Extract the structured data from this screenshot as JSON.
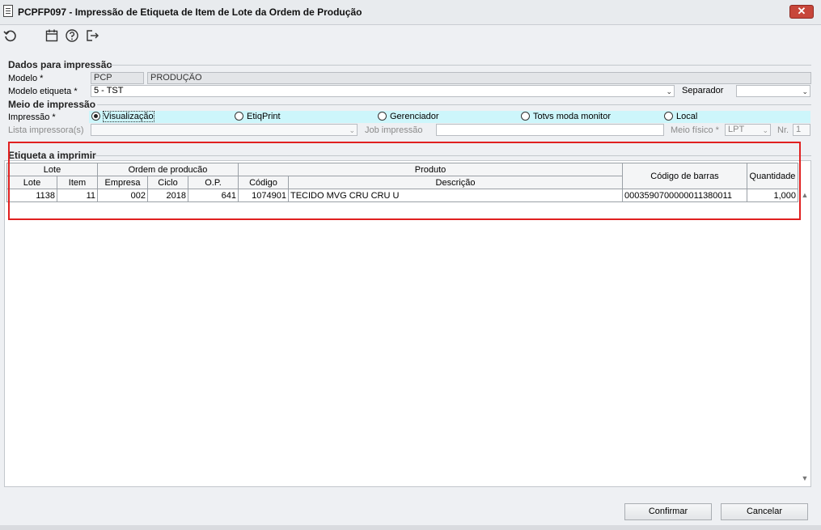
{
  "window": {
    "title": "PCPFP097 - Impressão de Etiqueta de Item de Lote da Ordem de Produção",
    "close_label": "✕"
  },
  "toolbar": {
    "icons": [
      "undo-icon",
      "calendar-icon",
      "help-icon",
      "exit-icon"
    ]
  },
  "dados": {
    "section_title": "Dados para impressão",
    "modelo_label": "Modelo *",
    "modelo_code": "PCP",
    "modelo_desc": "PRODUÇÃO",
    "modelo_etiqueta_label": "Modelo etiqueta *",
    "modelo_etiqueta_value": "5 - TST",
    "separador_label": "Separador",
    "separador_value": ""
  },
  "meio": {
    "section_title": "Meio de impressão",
    "impressao_label": "Impressão *",
    "options": [
      "Visualização",
      "EtiqPrint",
      "Gerenciador",
      "Totvs moda monitor",
      "Local"
    ],
    "selected": "Visualização",
    "lista_label": "Lista impressora(s)",
    "lista_value": "",
    "job_label": "Job impressão",
    "job_value": "",
    "meio_fisico_label": "Meio físico *",
    "meio_fisico_value": "LPT",
    "nr_label": "Nr.",
    "nr_value": "1"
  },
  "etiqueta": {
    "section_title": "Etiqueta a imprimir",
    "group_headers": {
      "lote": "Lote",
      "ordem": "Ordem de producão",
      "produto": "Produto",
      "barras": "Código de barras",
      "quantidade": "Quantidade"
    },
    "columns": {
      "lote": "Lote",
      "item": "Item",
      "empresa": "Empresa",
      "ciclo": "Ciclo",
      "op": "O.P.",
      "codigo": "Código",
      "descricao": "Descrição"
    },
    "rows": [
      {
        "lote": "1138",
        "item": "11",
        "empresa": "002",
        "ciclo": "2018",
        "op": "641",
        "codigo": "1074901",
        "descricao": "TECIDO MVG CRU CRU U",
        "barras": "0003590700000011380011",
        "quantidade": "1,000"
      }
    ]
  },
  "footer": {
    "confirm_label": "Confirmar",
    "cancel_label": "Cancelar"
  },
  "colors": {
    "highlight_strip": "#cdf6fb",
    "annotation_box": "#e02020",
    "close_button": "#c7463a"
  }
}
